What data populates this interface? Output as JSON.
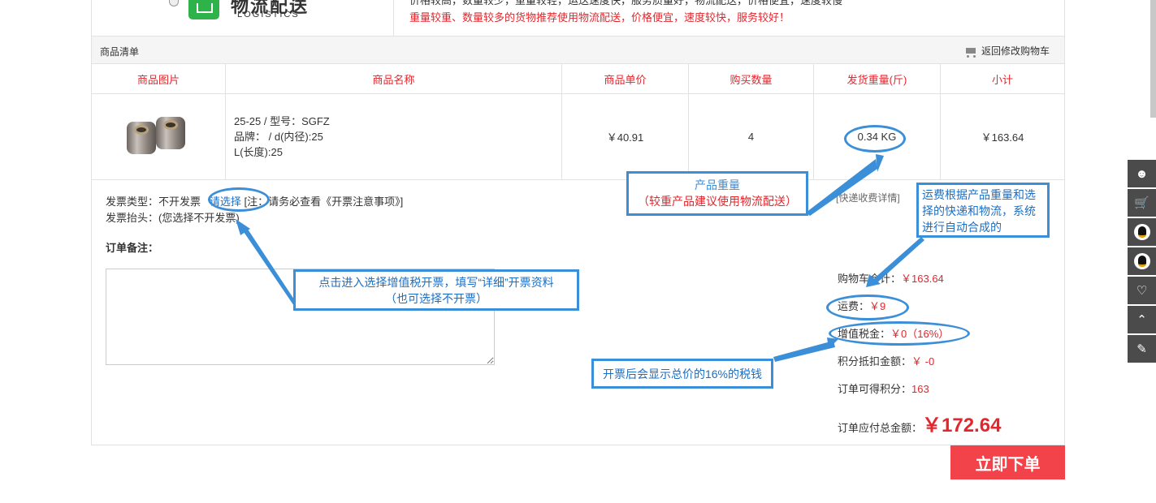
{
  "header": {
    "logo_cn": "物流配送",
    "logo_en": "LOGISTICS",
    "top_cut_text": "价格较高，数量较少，重量较轻，运送速度快，服务质量好，物流配送，价格便宜，速度较慢",
    "note": "重量较重、数量较多的货物推荐使用物流配送，价格便宜，速度较快，服务较好！"
  },
  "list": {
    "title": "商品清单",
    "back_label": "返回修改购物车",
    "columns": [
      "商品图片",
      "商品名称",
      "商品单价",
      "购买数量",
      "发货重量(斤)",
      "小计"
    ],
    "item": {
      "name_line1": "25-25 / 型号：SGFZ",
      "name_line2": "品牌： / d(内径):25",
      "name_line3": "L(长度):25",
      "price": "￥40.91",
      "qty": "4",
      "weight": "0.34 KG",
      "subtotal": "￥163.64"
    }
  },
  "invoice": {
    "type_label": "发票类型：不开发票",
    "choose": "请选择",
    "note": "[注：请务必查看《开票注意事项》]",
    "head": "发票抬头：(您选择不开发票)"
  },
  "remark": {
    "label": "订单备注：",
    "value": ""
  },
  "shipping_detail": "[快递收费详情]",
  "summary": {
    "cart_total_label": "购物车合计：",
    "cart_total": "￥163.64",
    "freight_label": "运费：",
    "freight": "￥9",
    "tax_label": "增值税金：",
    "tax": "￥0（16%）",
    "points_deduct_label": "积分抵扣金额：",
    "points_deduct": "￥ -0",
    "points_earn_label": "订单可得积分：",
    "points_earn": "163",
    "total_label": "订单应付总金额：",
    "total": "￥172.64"
  },
  "submit_label": "立即下单",
  "annotations": {
    "weight": "产品重量",
    "weight_sub": "（较重产品建议使用物流配送）",
    "freight": "运费根据产品重量和选择的快递和物流，系统进行自动合成的",
    "invoice": "点击进入选择增值税开票，填写“详细”开票资料",
    "invoice_sub": "（也可选择不开票）",
    "tax": "开票后会显示总价的16%的税钱"
  },
  "colors": {
    "accent_red": "#e3262d",
    "submit_bg": "#f2434a",
    "annotation_blue": "#3b8ed8",
    "sidebar_bg": "#4b4b4b"
  }
}
